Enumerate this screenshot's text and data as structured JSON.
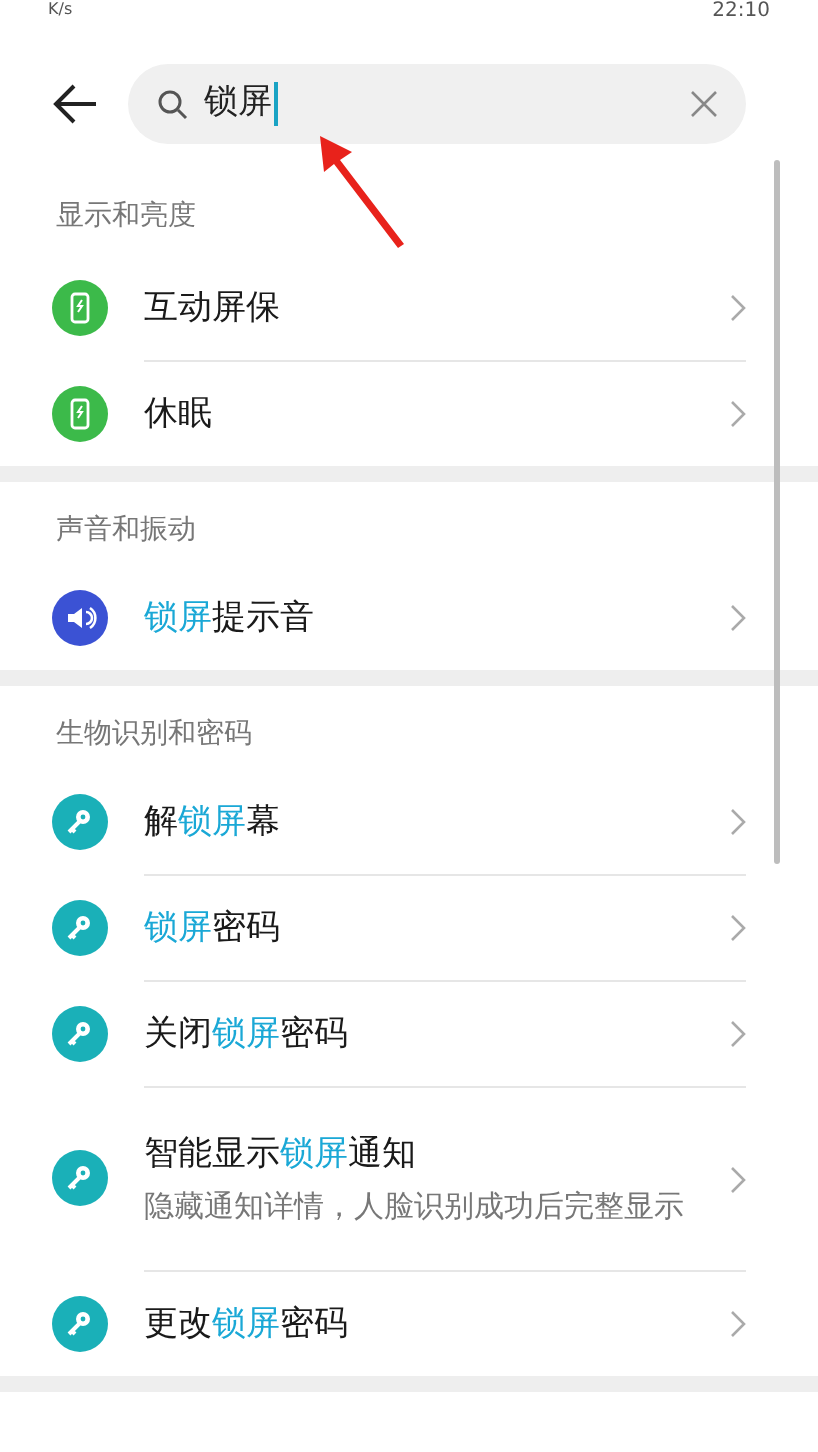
{
  "status_bar": {
    "speed": "K/s",
    "time": "22:10"
  },
  "search": {
    "value": "锁屏"
  },
  "sections": [
    {
      "title": "显示和亮度",
      "items": [
        {
          "kind": "phone",
          "title": [
            {
              "text": "互动屏保",
              "match": false
            }
          ]
        },
        {
          "kind": "phone",
          "title": [
            {
              "text": "休眠",
              "match": false
            }
          ]
        }
      ]
    },
    {
      "title": "声音和振动",
      "items": [
        {
          "kind": "speaker",
          "title": [
            {
              "text": "锁屏",
              "match": true
            },
            {
              "text": "提示音",
              "match": false
            }
          ]
        }
      ]
    },
    {
      "title": "生物识别和密码",
      "items": [
        {
          "kind": "key",
          "title": [
            {
              "text": "解",
              "match": false
            },
            {
              "text": "锁屏",
              "match": true
            },
            {
              "text": "幕",
              "match": false
            }
          ]
        },
        {
          "kind": "key",
          "title": [
            {
              "text": "锁屏",
              "match": true
            },
            {
              "text": "密码",
              "match": false
            }
          ]
        },
        {
          "kind": "key",
          "title": [
            {
              "text": "关闭",
              "match": false
            },
            {
              "text": "锁屏",
              "match": true
            },
            {
              "text": "密码",
              "match": false
            }
          ]
        },
        {
          "kind": "key",
          "title": [
            {
              "text": "智能显示",
              "match": false
            },
            {
              "text": "锁屏",
              "match": true
            },
            {
              "text": "通知",
              "match": false
            }
          ],
          "subtitle": "隐藏通知详情，人脸识别成功后完整显示"
        },
        {
          "kind": "key",
          "title": [
            {
              "text": "更改",
              "match": false
            },
            {
              "text": "锁屏",
              "match": true
            },
            {
              "text": "密码",
              "match": false
            }
          ]
        }
      ]
    }
  ]
}
